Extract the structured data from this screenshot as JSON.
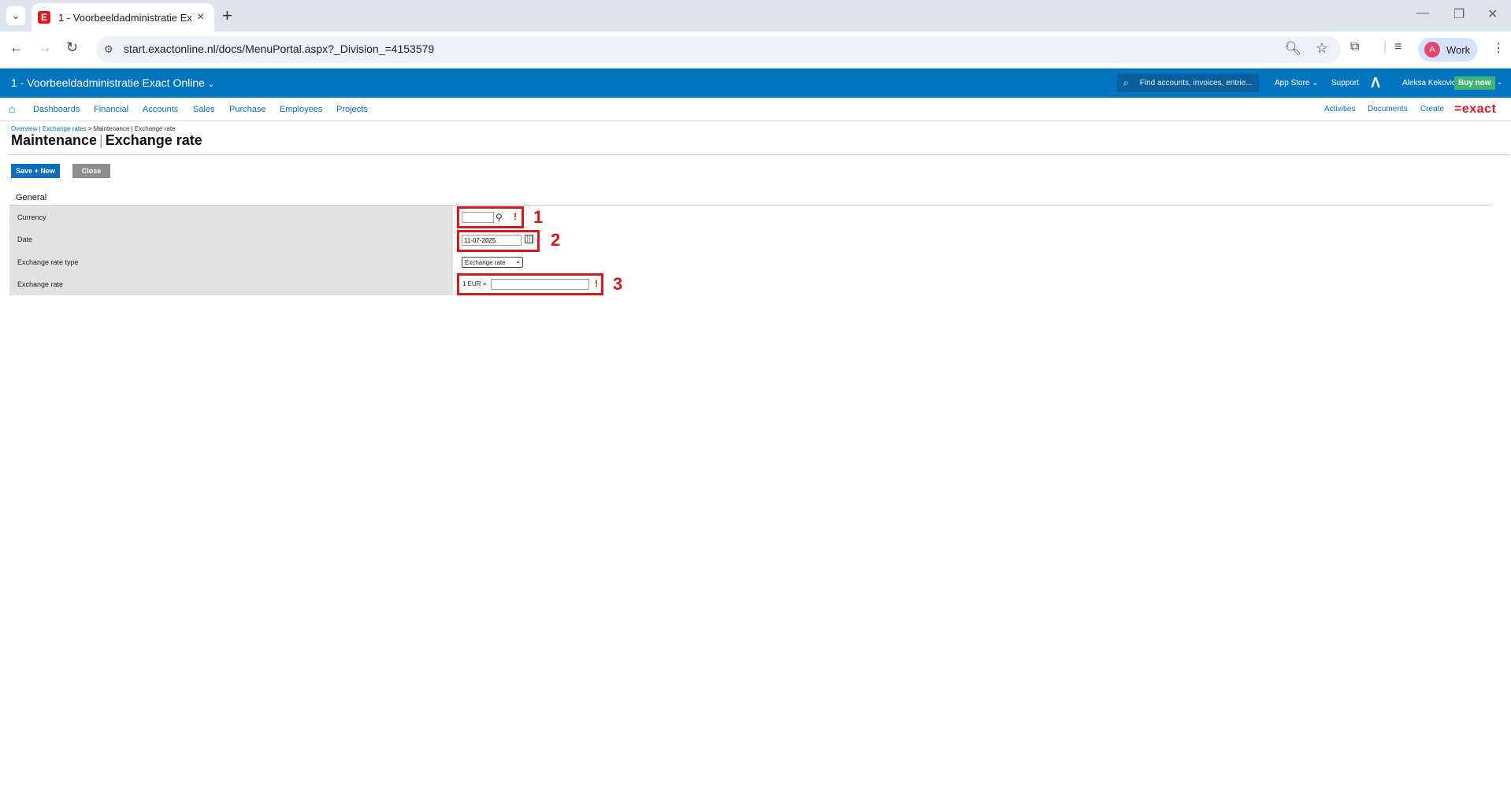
{
  "browser": {
    "tab_title": "1 - Voorbeeldadministratie Exact Online",
    "url": "start.exactonline.nl/docs/MenuPortal.aspx?_Division_=4153579",
    "profile_initial": "A",
    "profile_label": "Work"
  },
  "header": {
    "company": "1 - Voorbeeldadministratie Exact Online",
    "search_placeholder": "Find accounts, invoices, entrie...",
    "app_store": "App Store",
    "support": "Support",
    "user_name": "Aleksa Kekovic",
    "buy_now": "Buy now"
  },
  "menu": {
    "items": [
      "Dashboards",
      "Financial",
      "Accounts",
      "Sales",
      "Purchase",
      "Employees",
      "Projects"
    ],
    "right": [
      "Activities",
      "Documents",
      "Create"
    ],
    "logo": "=exact"
  },
  "page": {
    "breadcrumb": {
      "overview": "Overview",
      "divider": " | ",
      "exchange_rates": "Exchange rates",
      "trail": " > Maintenance | Exchange rate"
    },
    "title_part1": "Maintenance",
    "title_part2": "Exchange rate",
    "buttons": {
      "save_new": "Save + New",
      "close": "Close"
    },
    "section": "General",
    "fields": {
      "currency_label": "Currency",
      "currency_value": "",
      "date_label": "Date",
      "date_value": "11-07-2025",
      "type_label": "Exchange rate type",
      "type_value": "Exchange rate",
      "rate_label": "Exchange rate",
      "rate_prefix": "1 EUR =",
      "rate_value": ""
    }
  },
  "annotations": [
    "1",
    "2",
    "3"
  ],
  "colors": {
    "brand_blue": "#0075bf",
    "link_blue": "#0a6ebd",
    "exact_red": "#e0181f",
    "annotation_red": "#d7191f",
    "buy_now_green": "#3fb573"
  }
}
